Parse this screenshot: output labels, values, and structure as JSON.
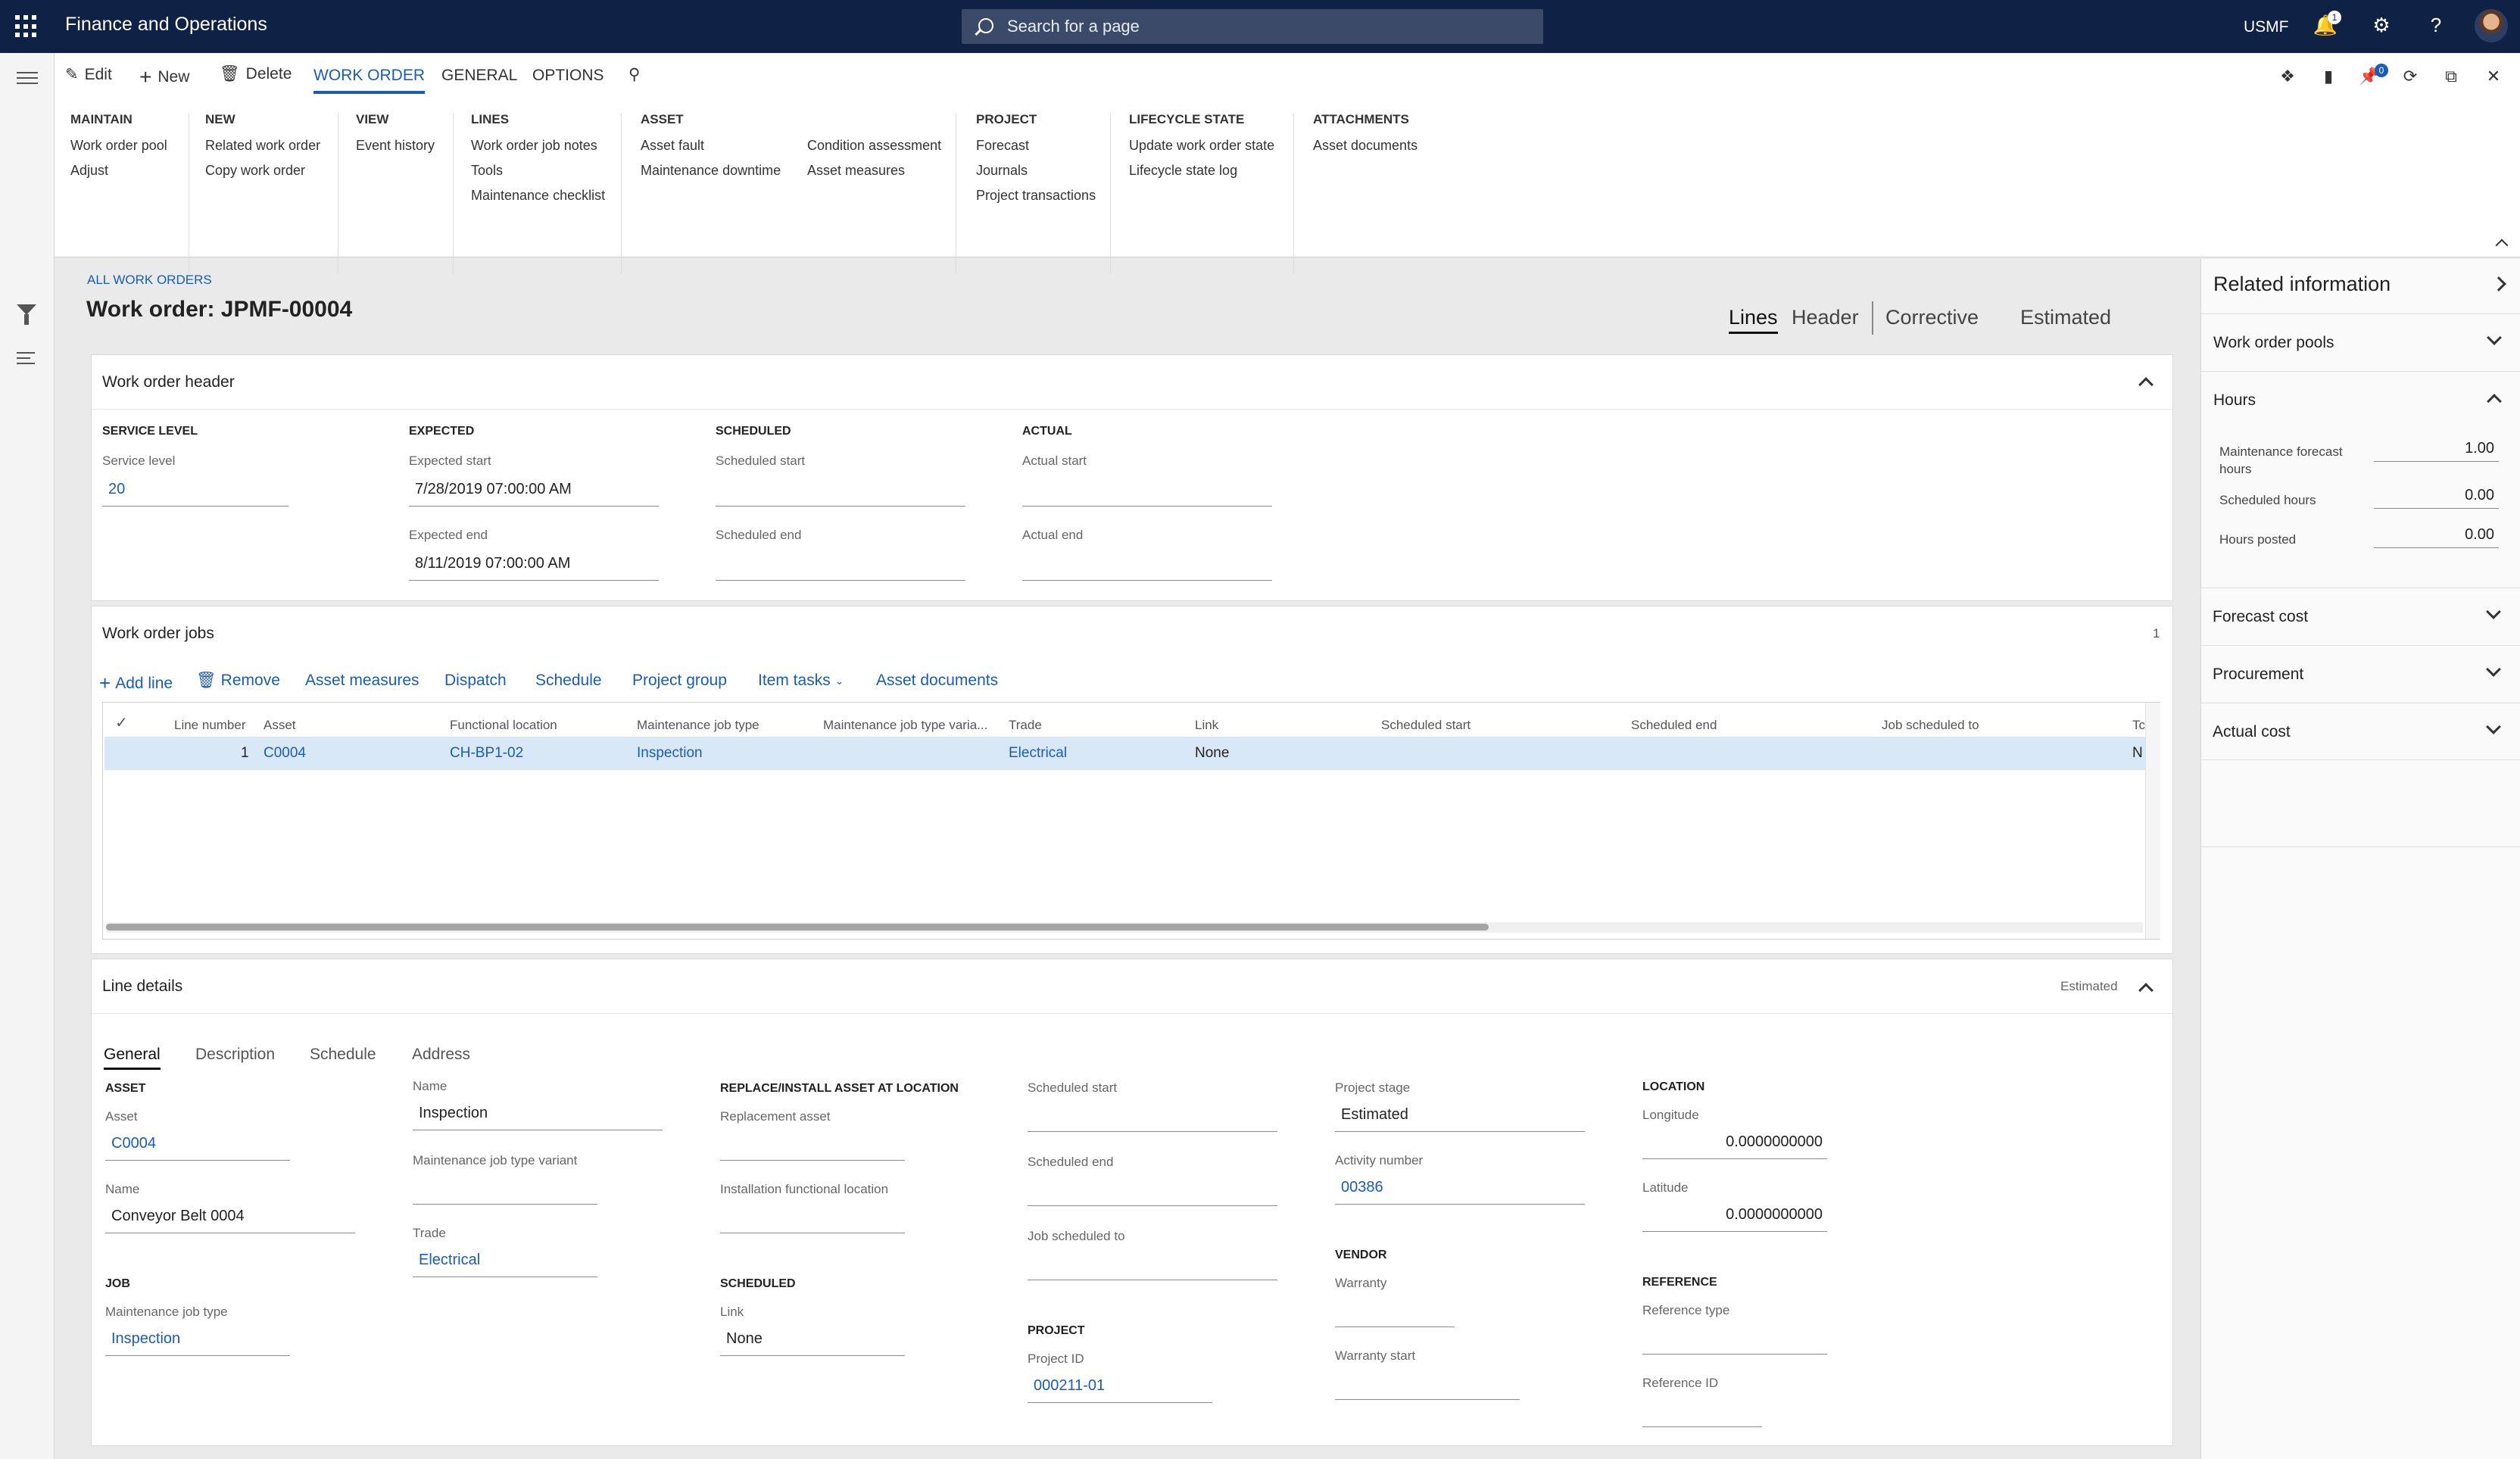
{
  "app": {
    "title": "Finance and Operations",
    "search_placeholder": "Search for a page",
    "company": "USMF",
    "notification_count": "1",
    "pane_badge": "0"
  },
  "action_pane": {
    "edit": "Edit",
    "new": "New",
    "delete": "Delete",
    "tabs": [
      "WORK ORDER",
      "GENERAL",
      "OPTIONS"
    ],
    "groups": [
      {
        "title": "MAINTAIN",
        "items": [
          "Work order pool",
          "Adjust"
        ]
      },
      {
        "title": "NEW",
        "items": [
          "Related work order",
          "Copy work order"
        ]
      },
      {
        "title": "VIEW",
        "items": [
          "Event history"
        ]
      },
      {
        "title": "LINES",
        "items": [
          "Work order job notes",
          "Tools",
          "Maintenance checklist"
        ]
      },
      {
        "title": "ASSET",
        "items": [
          "Asset fault",
          "Maintenance downtime"
        ],
        "items2": [
          "Condition assessment",
          "Asset measures"
        ]
      },
      {
        "title": "PROJECT",
        "items": [
          "Forecast",
          "Journals",
          "Project transactions"
        ]
      },
      {
        "title": "LIFECYCLE STATE",
        "items": [
          "Update work order state",
          "Lifecycle state log"
        ]
      },
      {
        "title": "ATTACHMENTS",
        "items": [
          "Asset documents"
        ]
      }
    ]
  },
  "page": {
    "breadcrumb": "ALL WORK ORDERS",
    "title": "Work order: JPMF-00004",
    "view_tabs": [
      "Lines",
      "Header",
      "Corrective",
      "Estimated"
    ]
  },
  "header_card": {
    "title": "Work order header",
    "service_level": {
      "section": "SERVICE LEVEL",
      "label": "Service level",
      "value": "20"
    },
    "expected": {
      "section": "EXPECTED",
      "start_label": "Expected start",
      "start": "7/28/2019 07:00:00 AM",
      "end_label": "Expected end",
      "end": "8/11/2019 07:00:00 AM"
    },
    "scheduled": {
      "section": "SCHEDULED",
      "start_label": "Scheduled start",
      "end_label": "Scheduled end"
    },
    "actual": {
      "section": "ACTUAL",
      "start_label": "Actual start",
      "end_label": "Actual end"
    }
  },
  "jobs_card": {
    "title": "Work order jobs",
    "count": "1",
    "toolbar": [
      "Add line",
      "Remove",
      "Asset measures",
      "Dispatch",
      "Schedule",
      "Project group",
      "Item tasks",
      "Asset documents"
    ],
    "columns": [
      "Line number",
      "Asset",
      "Functional location",
      "Maintenance job type",
      "Maintenance job type varia...",
      "Trade",
      "Link",
      "Scheduled start",
      "Scheduled end",
      "Job scheduled to",
      "Tc"
    ],
    "rows": [
      {
        "line": "1",
        "asset": "C0004",
        "location": "CH-BP1-02",
        "job_type": "Inspection",
        "variant": "",
        "trade": "Electrical",
        "link": "None",
        "sched_start": "",
        "sched_end": "",
        "sched_to": "",
        "tc": "N"
      }
    ]
  },
  "line_details": {
    "title": "Line details",
    "status": "Estimated",
    "tabs": [
      "General",
      "Description",
      "Schedule",
      "Address"
    ],
    "asset_section": "ASSET",
    "asset_label": "Asset",
    "asset": "C0004",
    "name_label": "Name",
    "asset_name": "Conveyor Belt 0004",
    "job_section": "JOB",
    "job_type_label": "Maintenance job type",
    "job_type": "Inspection",
    "job_name_label": "Name",
    "job_name": "Inspection",
    "variant_label": "Maintenance job type variant",
    "variant": "",
    "trade_label": "Trade",
    "trade": "Electrical",
    "replace_section": "REPLACE/INSTALL ASSET AT LOCATION",
    "replacement_label": "Replacement asset",
    "install_label": "Installation functional location",
    "scheduled_section": "SCHEDULED",
    "link_label": "Link",
    "link": "None",
    "sched_start_label": "Scheduled start",
    "sched_end_label": "Scheduled end",
    "sched_to_label": "Job scheduled to",
    "project_section": "PROJECT",
    "project_id_label": "Project ID",
    "project_id": "000211-01",
    "stage_label": "Project stage",
    "stage": "Estimated",
    "activity_label": "Activity number",
    "activity": "00386",
    "vendor_section": "VENDOR",
    "warranty_label": "Warranty",
    "warranty_start_label": "Warranty start",
    "location_section": "LOCATION",
    "longitude_label": "Longitude",
    "longitude": "0.0000000000",
    "latitude_label": "Latitude",
    "latitude": "0.0000000000",
    "reference_section": "REFERENCE",
    "ref_type_label": "Reference type",
    "ref_id_label": "Reference ID"
  },
  "related": {
    "title": "Related information",
    "sections": [
      "Work order pools",
      "Hours",
      "Forecast cost",
      "Procurement",
      "Actual cost"
    ],
    "hours": [
      {
        "label": "Maintenance forecast hours",
        "value": "1.00"
      },
      {
        "label": "Scheduled hours",
        "value": "0.00"
      },
      {
        "label": "Hours posted",
        "value": "0.00"
      }
    ]
  },
  "colors": {
    "topbar": "#0f2246",
    "accent": "#1b5cb4",
    "selected_row": "#d9e8f7"
  }
}
